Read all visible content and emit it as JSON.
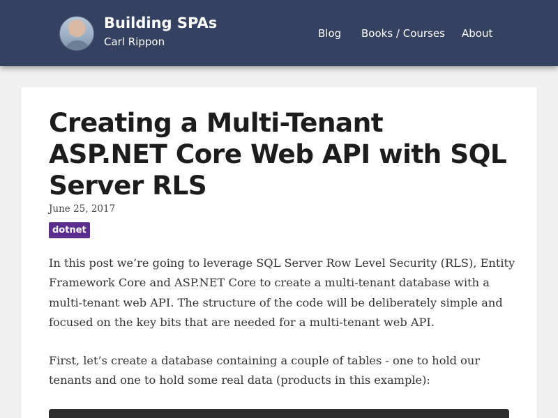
{
  "header": {
    "site_title": "Building SPAs",
    "author": "Carl Rippon",
    "nav": [
      {
        "label": "Blog"
      },
      {
        "label": "Books / Courses"
      },
      {
        "label": "About"
      }
    ]
  },
  "post": {
    "title": "Creating a Multi-Tenant ASP.NET Core Web API with SQL Server RLS",
    "date": "June 25, 2017",
    "tag": "dotnet",
    "paragraphs": [
      "In this post we’re going to leverage SQL Server Row Level Security (RLS), Entity Framework Core and ASP.NET Core to create a multi-tenant database with a multi-tenant web API. The structure of the code will be deliberately simple and focused on the key bits that are needed for a multi-tenant web API.",
      "First, let’s create a database containing a couple of tables - one to hold our tenants and one to hold some real data (products in this example):"
    ]
  },
  "colors": {
    "header_bg": "#344160",
    "page_bg": "#f0f0f0",
    "tag_bg": "#5a2d8f",
    "code_bg": "#2d2d2d"
  }
}
